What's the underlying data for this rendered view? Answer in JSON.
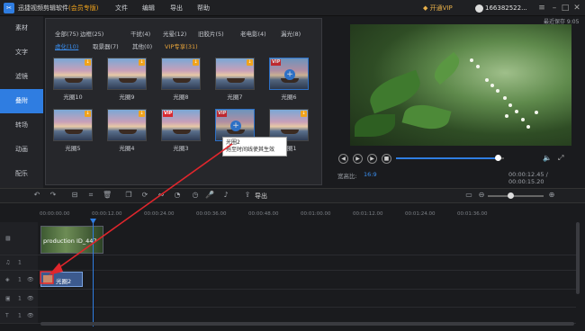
{
  "app": {
    "title": "迅捷视频剪辑软件",
    "edition": "(会员专版)",
    "menu": [
      "文件",
      "编辑",
      "导出",
      "帮助"
    ],
    "vip_button": "开通VIP",
    "user_id": "166382522...",
    "window_controls": [
      "menu-icon",
      "minimize-icon",
      "maximize-icon",
      "close-icon"
    ]
  },
  "nav": {
    "items": [
      {
        "label": "素材",
        "active": false
      },
      {
        "label": "文字",
        "active": false
      },
      {
        "label": "滤镜",
        "active": false
      },
      {
        "label": "叠附",
        "active": true
      },
      {
        "label": "转场",
        "active": false
      },
      {
        "label": "动画",
        "active": false
      },
      {
        "label": "配乐",
        "active": false
      }
    ]
  },
  "library": {
    "categories_row1": [
      "全部(75)",
      "边框(25)",
      "干扰(4)",
      "光晕(12)",
      "旧胶片(5)",
      "老电影(4)",
      "漏光(8)"
    ],
    "categories_row2": [
      "虚化(10)",
      "取景器(7)",
      "其他(0)",
      "VIP专享(31)"
    ],
    "selected_category": "虚化(10)",
    "items": [
      {
        "label": "光圈10",
        "badge": "download"
      },
      {
        "label": "光圈9",
        "badge": "download"
      },
      {
        "label": "光圈8",
        "badge": "download"
      },
      {
        "label": "光圈7",
        "badge": "download"
      },
      {
        "label": "光圈6",
        "badge": "vip"
      },
      {
        "label": "光圈5",
        "badge": "download"
      },
      {
        "label": "光圈4",
        "badge": "download"
      },
      {
        "label": "光圈3",
        "badge": "vip"
      },
      {
        "label": "光圈2",
        "badge": "vip"
      },
      {
        "label": "光圈1",
        "badge": "download"
      }
    ],
    "tooltip_title": "光圈2",
    "tooltip_text": "拖至时间线使其生效"
  },
  "preview": {
    "timestamp": "最近保存 9:05",
    "aspect_label": "宽高比:",
    "aspect_value": "16:9",
    "time": "00:00:12.45 / 00:00:15.20",
    "progress": 0.94
  },
  "toolbar": {
    "export_label": "导出",
    "zoom_level": 0.4
  },
  "timeline": {
    "ticks": [
      "00:00:00.00",
      "00:00:12.00",
      "00:00:24.00",
      "00:00:36.00",
      "00:00:48.00",
      "00:01:00.00",
      "00:01:12.00",
      "00:01:24.00",
      "00:01:36.00"
    ],
    "video_clip_label": "production ID_447",
    "effect_clip_label": "光圈2",
    "track_labels": [
      "1",
      "1",
      "1",
      "1"
    ]
  },
  "colors": {
    "accent": "#2f7de1",
    "vip": "#f0a31c",
    "annotation_arrow": "#e0262c"
  }
}
